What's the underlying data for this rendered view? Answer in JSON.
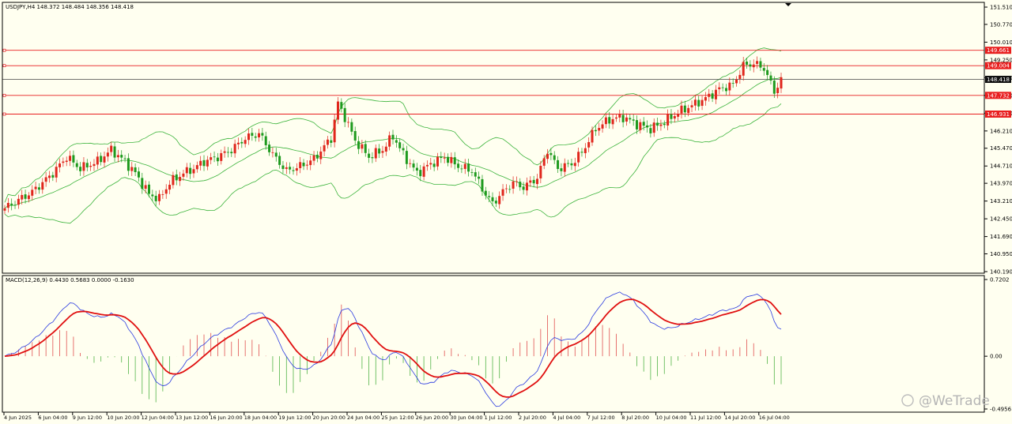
{
  "header": {
    "info": "USDJPY,H4  148.372 148.484 148.356 148.418",
    "macd_info": "MACD(12,26,9) 0.4430 0.5683 0.0000 -0.1630"
  },
  "watermark": "@WeTrade",
  "colors": {
    "background": "#fffff0",
    "bull": "#e0261c",
    "bear": "#1e9a1e",
    "bands": "#3cb43c",
    "level_line": "#e81f1f",
    "price_line": "#444444",
    "macd_line": "#2b3be0",
    "signal_line": "#e01010",
    "hist_pos": "#e05050",
    "hist_neg": "#52b447"
  },
  "chart_data": [
    {
      "type": "candlestick",
      "symbol": "USDJPY",
      "timeframe": "H4",
      "ylim": [
        140.19,
        151.51
      ],
      "y_ticks": [
        "151.510",
        "150.770",
        "150.010",
        "149.250",
        "148.490",
        "147.730",
        "146.970",
        "146.210",
        "145.470",
        "144.710",
        "143.970",
        "143.210",
        "142.450",
        "141.690",
        "140.950",
        "140.190"
      ],
      "x_ticks": [
        "4 Jun 2025",
        "6 Jun 04:00",
        "9 Jun 12:00",
        "10 Jun 20:00",
        "12 Jun 04:00",
        "13 Jun 12:00",
        "16 Jun 20:00",
        "18 Jun 04:00",
        "19 Jun 12:00",
        "20 Jun 20:00",
        "24 Jun 04:00",
        "25 Jun 12:00",
        "26 Jun 20:00",
        "30 Jun 04:00",
        "1 Jul 12:00",
        "2 Jul 20:00",
        "4 Jul 04:00",
        "7 Jul 12:00",
        "8 Jul 20:00",
        "10 Jul 04:00",
        "11 Jul 12:00",
        "14 Jul 20:00",
        "16 Jul 04:00"
      ],
      "levels": [
        {
          "label": "149.661",
          "value": 149.661
        },
        {
          "label": "149.004",
          "value": 149.004
        },
        {
          "label": "147.732",
          "value": 147.732
        },
        {
          "label": "146.931",
          "value": 146.931
        }
      ],
      "current_price": {
        "label": "148.418",
        "value": 148.418
      },
      "close_path": [
        [
          0,
          142.9
        ],
        [
          8,
          143.6
        ],
        [
          14,
          144.4
        ],
        [
          18,
          145.1
        ],
        [
          22,
          144.6
        ],
        [
          27,
          144.9
        ],
        [
          31,
          145.4
        ],
        [
          35,
          144.9
        ],
        [
          38,
          144.4
        ],
        [
          42,
          143.5
        ],
        [
          45,
          143.3
        ],
        [
          48,
          144.0
        ],
        [
          52,
          144.4
        ],
        [
          55,
          144.6
        ],
        [
          58,
          144.9
        ],
        [
          62,
          145.1
        ],
        [
          66,
          145.4
        ],
        [
          70,
          145.9
        ],
        [
          74,
          146.1
        ],
        [
          78,
          145.2
        ],
        [
          82,
          144.5
        ],
        [
          86,
          144.7
        ],
        [
          90,
          145.0
        ],
        [
          95,
          145.9
        ],
        [
          97,
          147.4
        ],
        [
          99,
          146.8
        ],
        [
          102,
          145.8
        ],
        [
          106,
          145.1
        ],
        [
          110,
          145.4
        ],
        [
          113,
          146.0
        ],
        [
          116,
          145.2
        ],
        [
          120,
          144.4
        ],
        [
          124,
          144.8
        ],
        [
          128,
          145.1
        ],
        [
          132,
          144.7
        ],
        [
          136,
          144.5
        ],
        [
          140,
          143.5
        ],
        [
          142,
          143.1
        ],
        [
          145,
          143.6
        ],
        [
          148,
          144.0
        ],
        [
          151,
          143.8
        ],
        [
          155,
          144.2
        ],
        [
          158,
          145.4
        ],
        [
          161,
          144.6
        ],
        [
          165,
          144.8
        ],
        [
          168,
          145.3
        ],
        [
          172,
          146.3
        ],
        [
          176,
          146.7
        ],
        [
          180,
          146.8
        ],
        [
          184,
          146.5
        ],
        [
          188,
          146.3
        ],
        [
          192,
          146.6
        ],
        [
          196,
          147.0
        ],
        [
          200,
          147.3
        ],
        [
          204,
          147.6
        ],
        [
          208,
          148.0
        ],
        [
          212,
          148.2
        ],
        [
          215,
          149.0
        ],
        [
          218,
          149.1
        ],
        [
          221,
          148.9
        ],
        [
          224,
          147.9
        ],
        [
          226,
          148.4
        ]
      ],
      "macd_ylim": [
        -0.4956,
        0.7202
      ],
      "macd_ticks": [
        "0.7202",
        "0.00",
        "-0.4956"
      ]
    }
  ]
}
